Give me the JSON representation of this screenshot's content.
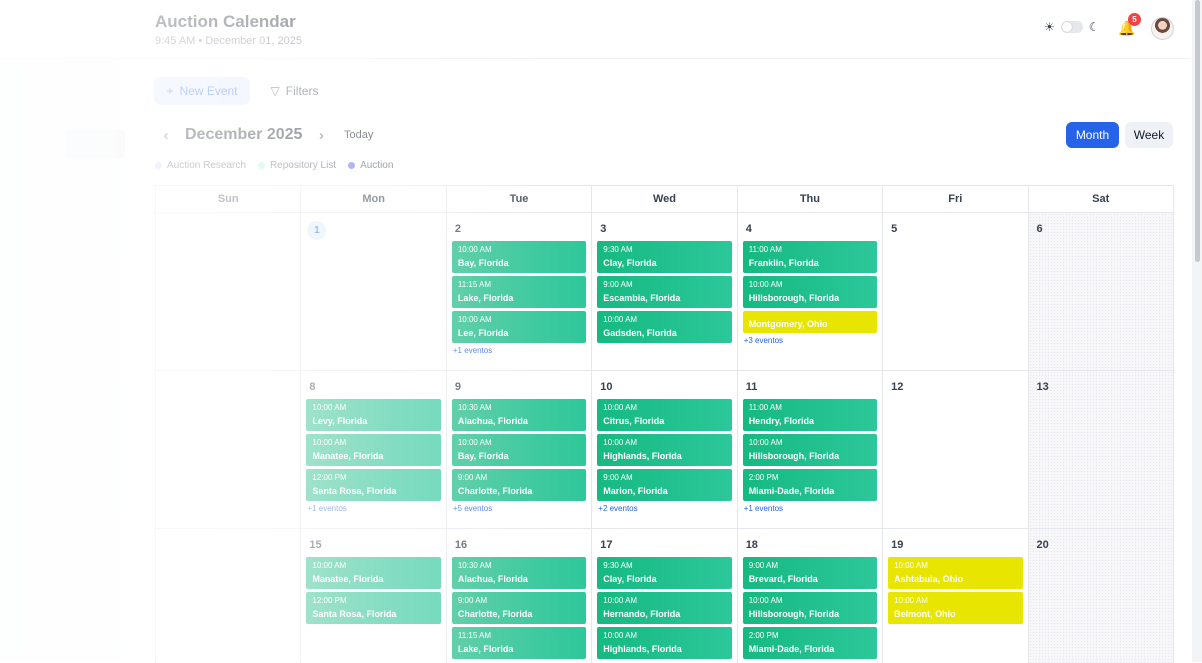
{
  "header": {
    "title": "Auction Calendar",
    "subtitle": "9:45 AM • December 01, 2025",
    "notification_count": "5"
  },
  "toolbar": {
    "new_event_label": "New Event",
    "filters_label": "Filters",
    "month_label": "December 2025",
    "today_label": "Today",
    "month_view_label": "Month",
    "week_view_label": "Week"
  },
  "legend": [
    {
      "label": "Auction Research",
      "color": "#c7d2fe"
    },
    {
      "label": "Repository List",
      "color": "#a7f3d0"
    },
    {
      "label": "Auction",
      "color": "#6366f1"
    }
  ],
  "calendar": {
    "weekdays": [
      "Sun",
      "Mon",
      "Tue",
      "Wed",
      "Thu",
      "Fri",
      "Sat"
    ],
    "weeks": [
      [
        {
          "date": ""
        },
        {
          "date": "1",
          "current": true
        },
        {
          "date": "2",
          "events": [
            {
              "time": "10:00 AM",
              "place": "Bay, Florida"
            },
            {
              "time": "11:15 AM",
              "place": "Lake, Florida"
            },
            {
              "time": "10:00 AM",
              "place": "Lee, Florida"
            }
          ],
          "more": "+1 eventos"
        },
        {
          "date": "3",
          "events": [
            {
              "time": "9:30 AM",
              "place": "Clay, Florida"
            },
            {
              "time": "9:00 AM",
              "place": "Escambia, Florida"
            },
            {
              "time": "10:00 AM",
              "place": "Gadsden, Florida"
            }
          ]
        },
        {
          "date": "4",
          "events": [
            {
              "time": "11:00 AM",
              "place": "Franklin, Florida"
            },
            {
              "time": "10:00 AM",
              "place": "Hillsborough, Florida"
            },
            {
              "time": "",
              "place": "Montgomery, Ohio",
              "yellow": true,
              "short": true
            }
          ],
          "more": "+3 eventos"
        },
        {
          "date": "5"
        },
        {
          "date": "6",
          "sat": true
        }
      ],
      [
        {
          "date": ""
        },
        {
          "date": "8",
          "events": [
            {
              "time": "10:00 AM",
              "place": "Levy, Florida"
            },
            {
              "time": "10:00 AM",
              "place": "Manatee, Florida"
            },
            {
              "time": "12:00 PM",
              "place": "Santa Rosa, Florida"
            }
          ],
          "more": "+1 eventos"
        },
        {
          "date": "9",
          "events": [
            {
              "time": "10:30 AM",
              "place": "Alachua, Florida"
            },
            {
              "time": "10:00 AM",
              "place": "Bay, Florida"
            },
            {
              "time": "9:00 AM",
              "place": "Charlotte, Florida"
            }
          ],
          "more": "+5 eventos"
        },
        {
          "date": "10",
          "events": [
            {
              "time": "10:00 AM",
              "place": "Citrus, Florida"
            },
            {
              "time": "10:00 AM",
              "place": "Highlands, Florida"
            },
            {
              "time": "9:00 AM",
              "place": "Marion, Florida"
            }
          ],
          "more": "+2 eventos"
        },
        {
          "date": "11",
          "events": [
            {
              "time": "11:00 AM",
              "place": "Hendry, Florida"
            },
            {
              "time": "10:00 AM",
              "place": "Hillsborough, Florida"
            },
            {
              "time": "2:00 PM",
              "place": "Miami-Dade, Florida"
            }
          ],
          "more": "+1 eventos"
        },
        {
          "date": "12"
        },
        {
          "date": "13",
          "sat": true
        }
      ],
      [
        {
          "date": ""
        },
        {
          "date": "15",
          "events": [
            {
              "time": "10:00 AM",
              "place": "Manatee, Florida"
            },
            {
              "time": "12:00 PM",
              "place": "Santa Rosa, Florida"
            }
          ]
        },
        {
          "date": "16",
          "events": [
            {
              "time": "10:30 AM",
              "place": "Alachua, Florida"
            },
            {
              "time": "9:00 AM",
              "place": "Charlotte, Florida"
            },
            {
              "time": "11:15 AM",
              "place": "Lake, Florida"
            }
          ]
        },
        {
          "date": "17",
          "events": [
            {
              "time": "9:30 AM",
              "place": "Clay, Florida"
            },
            {
              "time": "10:00 AM",
              "place": "Hernando, Florida"
            },
            {
              "time": "10:00 AM",
              "place": "Highlands, Florida"
            }
          ]
        },
        {
          "date": "18",
          "events": [
            {
              "time": "9:00 AM",
              "place": "Brevard, Florida"
            },
            {
              "time": "10:00 AM",
              "place": "Hillsborough, Florida"
            },
            {
              "time": "2:00 PM",
              "place": "Miami-Dade, Florida"
            }
          ]
        },
        {
          "date": "19",
          "events": [
            {
              "time": "10:00 AM",
              "place": "Ashtabula, Ohio",
              "yellow": true
            },
            {
              "time": "10:00 AM",
              "place": "Belmont, Ohio",
              "yellow": true
            }
          ]
        },
        {
          "date": "20",
          "sat": true
        }
      ]
    ]
  }
}
